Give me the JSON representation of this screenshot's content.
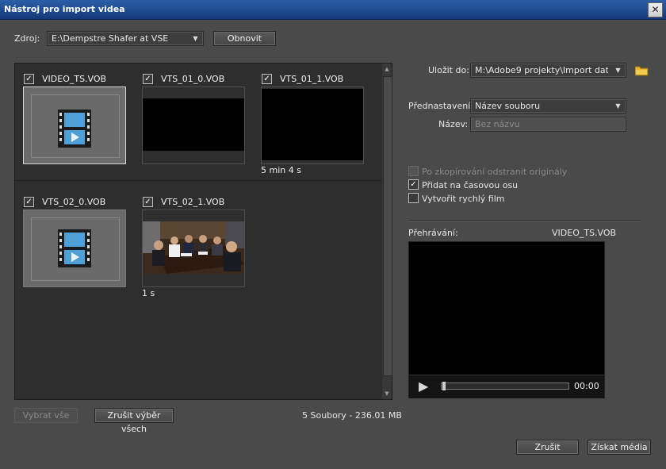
{
  "window": {
    "title": "Nástroj pro import videa",
    "close_glyph": "✕"
  },
  "source": {
    "label": "Zdroj:",
    "value": "E:\\Dempstre Shafer at VSE",
    "refresh_label": "Obnovit"
  },
  "files": [
    {
      "name": "VIDEO_TS.VOB",
      "checked": true,
      "check_glyph": "✓",
      "thumb": "film-icon",
      "caption": ""
    },
    {
      "name": "VTS_01_0.VOB",
      "checked": true,
      "check_glyph": "✓",
      "thumb": "black",
      "caption": ""
    },
    {
      "name": "VTS_01_1.VOB",
      "checked": true,
      "check_glyph": "✓",
      "thumb": "black",
      "caption": "5 min 4 s"
    },
    {
      "name": "VTS_02_0.VOB",
      "checked": true,
      "check_glyph": "✓",
      "thumb": "film-icon",
      "caption": ""
    },
    {
      "name": "VTS_02_1.VOB",
      "checked": true,
      "check_glyph": "✓",
      "thumb": "meeting-photo",
      "caption": "1 s"
    }
  ],
  "grid_footer": {
    "select_all": "Vybrat vše",
    "deselect_all": "Zrušit výběr všech",
    "summary": "5 Soubory - 236.01 MB"
  },
  "save_to": {
    "label": "Uložit do:",
    "value": "M:\\Adobe9 projekty\\Import dat"
  },
  "preset": {
    "label": "Přednastavení:",
    "value": "Název souboru"
  },
  "name": {
    "label": "Název:",
    "placeholder": "Bez názvu"
  },
  "options": [
    {
      "label": "Po zkopírování odstranit originály",
      "checked": false,
      "disabled": true
    },
    {
      "label": "Přidat na časovou osu",
      "checked": true,
      "disabled": false,
      "check_glyph": "✓"
    },
    {
      "label": "Vytvořit rychlý film",
      "checked": false,
      "disabled": false
    }
  ],
  "playback": {
    "label": "Přehrávání:",
    "file": "VIDEO_TS.VOB",
    "time": "00:00",
    "play_glyph": "▶"
  },
  "footer": {
    "cancel": "Zrušit",
    "get_media": "Získat média"
  },
  "glyphs": {
    "dropdown": "▼",
    "scroll_up": "▲",
    "scroll_down": "▼"
  },
  "colors": {
    "accent_blue": "#1f4c95",
    "panel": "#4a4a4a",
    "grid_bg": "#2e2e2e",
    "folder": "#e8b62a"
  }
}
